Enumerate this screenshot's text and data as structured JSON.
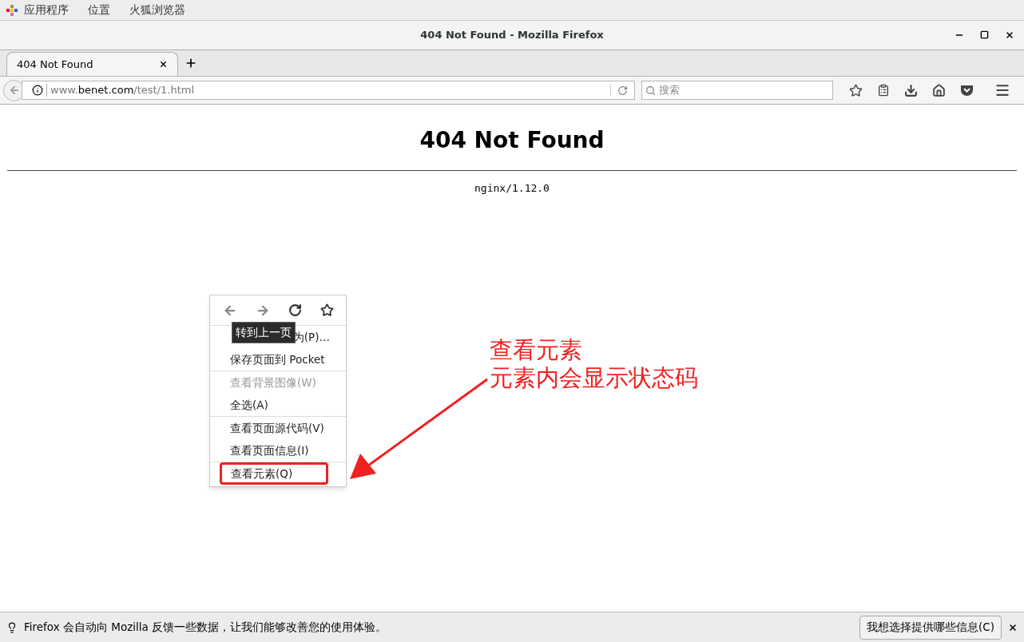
{
  "top_bar": {
    "menus": [
      "应用程序",
      "位置",
      "火狐浏览器"
    ]
  },
  "window": {
    "title": "404 Not Found - Mozilla Firefox"
  },
  "tabs": [
    {
      "label": "404 Not Found",
      "selected": true
    }
  ],
  "address_bar": {
    "prefix": "www.",
    "domain": "benet.com",
    "path": "/test/1.html"
  },
  "search": {
    "placeholder": "搜索"
  },
  "page": {
    "heading": "404 Not Found",
    "server": "nginx/1.12.0"
  },
  "context_menu": {
    "tooltip": "转到上一页",
    "items": [
      {
        "label": "为(P)…",
        "disabled": false,
        "separator_after": false,
        "highlighted": false
      },
      {
        "label": "保存页面到 Pocket",
        "disabled": false,
        "separator_after": true,
        "highlighted": false
      },
      {
        "label": "查看背景图像(W)",
        "disabled": true,
        "separator_after": false,
        "highlighted": false
      },
      {
        "label": "全选(A)",
        "disabled": false,
        "separator_after": true,
        "highlighted": false
      },
      {
        "label": "查看页面源代码(V)",
        "disabled": false,
        "separator_after": false,
        "highlighted": false
      },
      {
        "label": "查看页面信息(I)",
        "disabled": false,
        "separator_after": true,
        "highlighted": false
      },
      {
        "label": "查看元素(Q)",
        "disabled": false,
        "separator_after": false,
        "highlighted": true
      }
    ]
  },
  "annotation": {
    "lines": [
      "查看元素",
      "元素内会显示状态码"
    ]
  },
  "notification": {
    "text": "Firefox 会自动向 Mozilla 反馈一些数据，让我们能够改善您的使用体验。",
    "button": "我想选择提供哪些信息(C)"
  }
}
